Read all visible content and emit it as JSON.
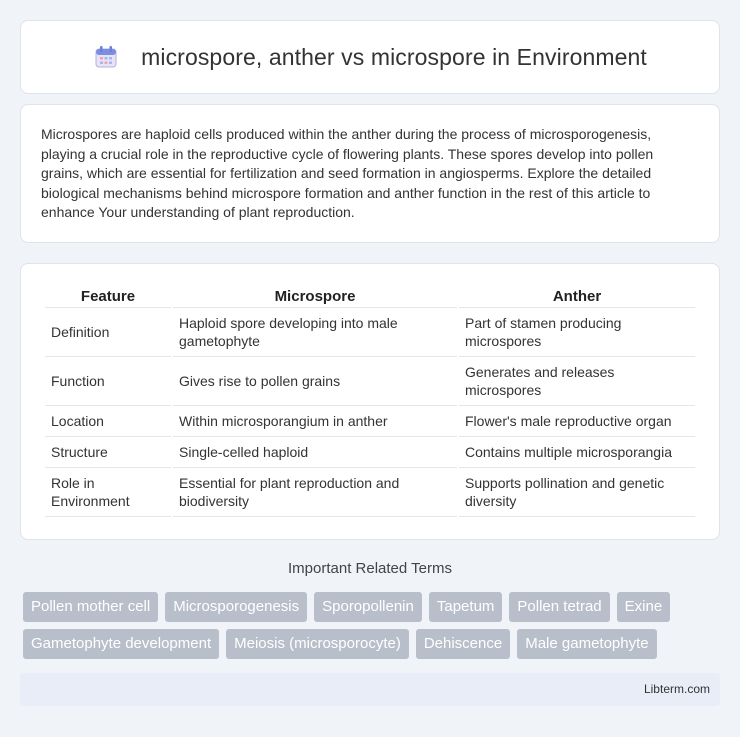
{
  "header": {
    "title": "microspore, anther vs microspore in Environment",
    "icon": "calendar-icon"
  },
  "intro": {
    "text": "Microspores are haploid cells produced within the anther during the process of microsporogenesis, playing a crucial role in the reproductive cycle of flowering plants. These spores develop into pollen grains, which are essential for fertilization and seed formation in angiosperms. Explore the detailed biological mechanisms behind microspore formation and anther function in the rest of this article to enhance Your understanding of plant reproduction."
  },
  "table": {
    "headers": [
      "Feature",
      "Microspore",
      "Anther"
    ],
    "rows": [
      {
        "feature": "Definition",
        "microspore": "Haploid spore developing into male gametophyte",
        "anther": "Part of stamen producing microspores"
      },
      {
        "feature": "Function",
        "microspore": "Gives rise to pollen grains",
        "anther": "Generates and releases microspores"
      },
      {
        "feature": "Location",
        "microspore": "Within microsporangium in anther",
        "anther": "Flower's male reproductive organ"
      },
      {
        "feature": "Structure",
        "microspore": "Single-celled haploid",
        "anther": "Contains multiple microsporangia"
      },
      {
        "feature": "Role in Environment",
        "microspore": "Essential for plant reproduction and biodiversity",
        "anther": "Supports pollination and genetic diversity"
      }
    ]
  },
  "related": {
    "title": "Important Related Terms",
    "tags": [
      "Pollen mother cell",
      "Microsporogenesis",
      "Sporopollenin",
      "Tapetum",
      "Pollen tetrad",
      "Exine",
      "Gametophyte development",
      "Meiosis (microsporocyte)",
      "Dehiscence",
      "Male gametophyte"
    ]
  },
  "footer": {
    "site": "Libterm.com"
  }
}
